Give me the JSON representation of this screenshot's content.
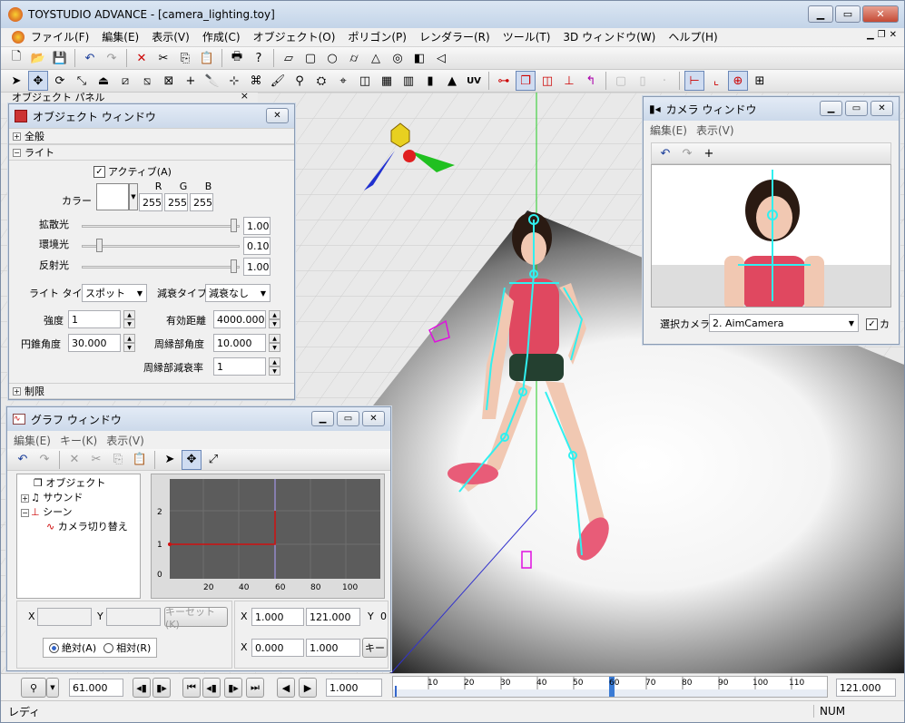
{
  "window": {
    "title": "TOYSTUDIO ADVANCE - [camera_lighting.toy]"
  },
  "menu": [
    "ファイル(F)",
    "編集(E)",
    "表示(V)",
    "作成(C)",
    "オブジェクト(O)",
    "ポリゴン(P)",
    "レンダラー(R)",
    "ツール(T)",
    "3D ウィンドウ(W)",
    "ヘルプ(H)"
  ],
  "panel_label": "オブジェクト パネル",
  "object_window": {
    "title": "オブジェクト ウィンドウ",
    "sections": {
      "all": "全般",
      "light": "ライト",
      "limit": "制限"
    },
    "active_label": "アクティブ(A)",
    "color_label": "カラー",
    "rgb_headers": [
      "R",
      "G",
      "B"
    ],
    "rgb_values": [
      "255",
      "255",
      "255"
    ],
    "sliders": [
      {
        "label": "拡散光",
        "value": "1.00",
        "level": 1.0
      },
      {
        "label": "環境光",
        "value": "0.10",
        "level": 0.1
      },
      {
        "label": "反射光",
        "value": "1.00",
        "level": 1.0
      }
    ],
    "light_type_label": "ライト タイプ",
    "light_type": "スポット",
    "decay_type_label": "減衰タイプ",
    "decay_type": "減衰なし",
    "strength_label": "強度",
    "strength": "1",
    "range_label": "有効距離",
    "range": "4000.000",
    "cone_label": "円錐角度",
    "cone": "30.000",
    "edge_label": "周縁部角度",
    "edge": "10.000",
    "edge_decay_label": "周縁部減衰率",
    "edge_decay": "1"
  },
  "graph_window": {
    "title": "グラフ ウィンドウ",
    "menu": [
      "編集(E)",
      "キー(K)",
      "表示(V)"
    ],
    "tree": [
      "オブジェクト",
      "サウンド",
      "シーン",
      "カメラ切り替え"
    ],
    "yticks": [
      "2",
      "1",
      "0"
    ],
    "xticks": [
      "20",
      "40",
      "60",
      "80",
      "100"
    ],
    "x_label": "X",
    "y_label": "Y",
    "key_set": "キーセット(K)",
    "abs": "絶対(A)",
    "rel": "相対(R)",
    "r1x": "1.000",
    "r1y": "121.000",
    "r1ylabel": "Y",
    "r1yval": "0",
    "r2x": "0.000",
    "r2y": "1.000",
    "r2btn": "キー"
  },
  "camera_window": {
    "title": "カメラ ウィンドウ",
    "menu": [
      "編集(E)",
      "表示(V)"
    ],
    "select_label": "選択カメラ",
    "camera": "2. AimCamera",
    "check_label": "カ"
  },
  "timeline": {
    "current": "61.000",
    "speed": "1.000",
    "end": "121.000",
    "ticks": [
      "10",
      "20",
      "30",
      "40",
      "50",
      "60",
      "70",
      "80",
      "90",
      "100",
      "110"
    ]
  },
  "status": {
    "text": "レディ",
    "num": "NUM"
  }
}
